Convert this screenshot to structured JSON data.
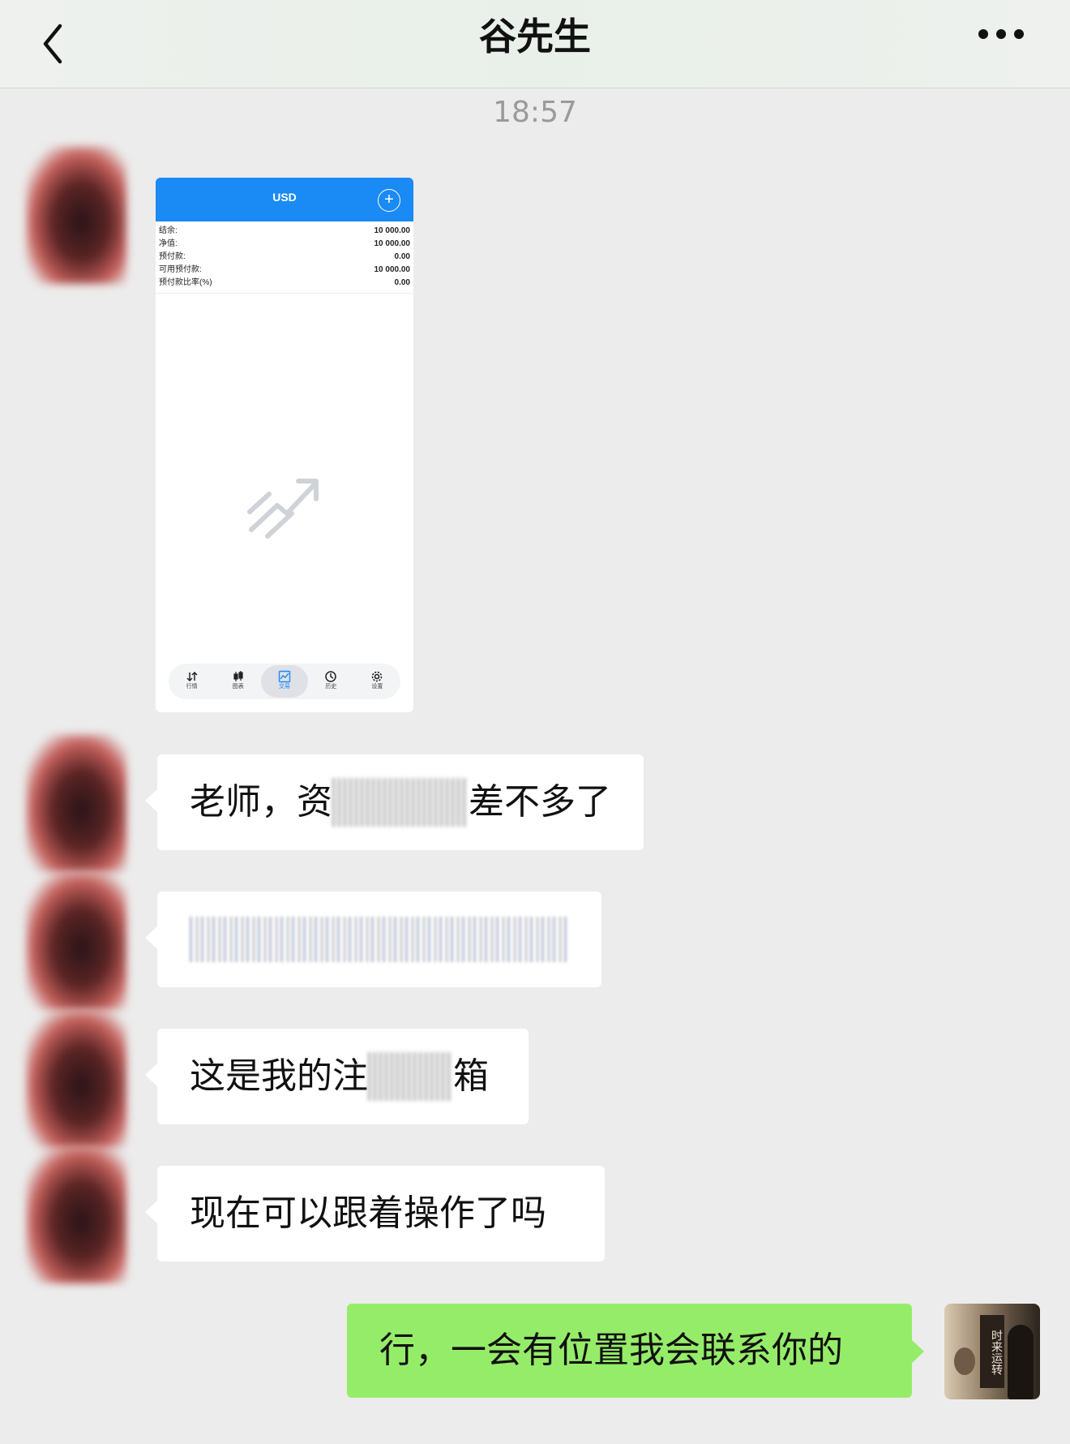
{
  "header": {
    "title": "谷先生",
    "back_icon": "chevron-left-icon",
    "more_icon": "more-dots-icon"
  },
  "timestamp": "18:57",
  "screenshot_card": {
    "currency": "USD",
    "rows": [
      {
        "label": "结余:",
        "value": "10 000.00"
      },
      {
        "label": "净值:",
        "value": "10 000.00"
      },
      {
        "label": "预付款:",
        "value": "0.00"
      },
      {
        "label": "可用预付款:",
        "value": "10 000.00"
      },
      {
        "label": "预付款比率(%)",
        "value": "0.00"
      }
    ],
    "nav": [
      {
        "label": "行情",
        "icon": "arrows-updown-icon"
      },
      {
        "label": "图表",
        "icon": "candlestick-icon"
      },
      {
        "label": "交易",
        "icon": "trade-chart-icon",
        "active": true
      },
      {
        "label": "历史",
        "icon": "history-clock-icon"
      },
      {
        "label": "设置",
        "icon": "gear-icon"
      }
    ],
    "accent_color": "#1a8af4"
  },
  "messages": [
    {
      "side": "left",
      "text_before": "老师，资",
      "text_after": "差不多了"
    },
    {
      "side": "left",
      "text_before": "",
      "text_after": ""
    },
    {
      "side": "left",
      "text_before": "这是我的注",
      "text_after": "箱"
    },
    {
      "side": "left",
      "text": "现在可以跟着操作了吗"
    },
    {
      "side": "right",
      "text": "行，一会有位置我会联系你的"
    }
  ],
  "my_avatar": {
    "scroll_text": "时来运转"
  },
  "colors": {
    "background": "#ececec",
    "sent_bubble": "#95ec69",
    "received_bubble": "#ffffff"
  }
}
